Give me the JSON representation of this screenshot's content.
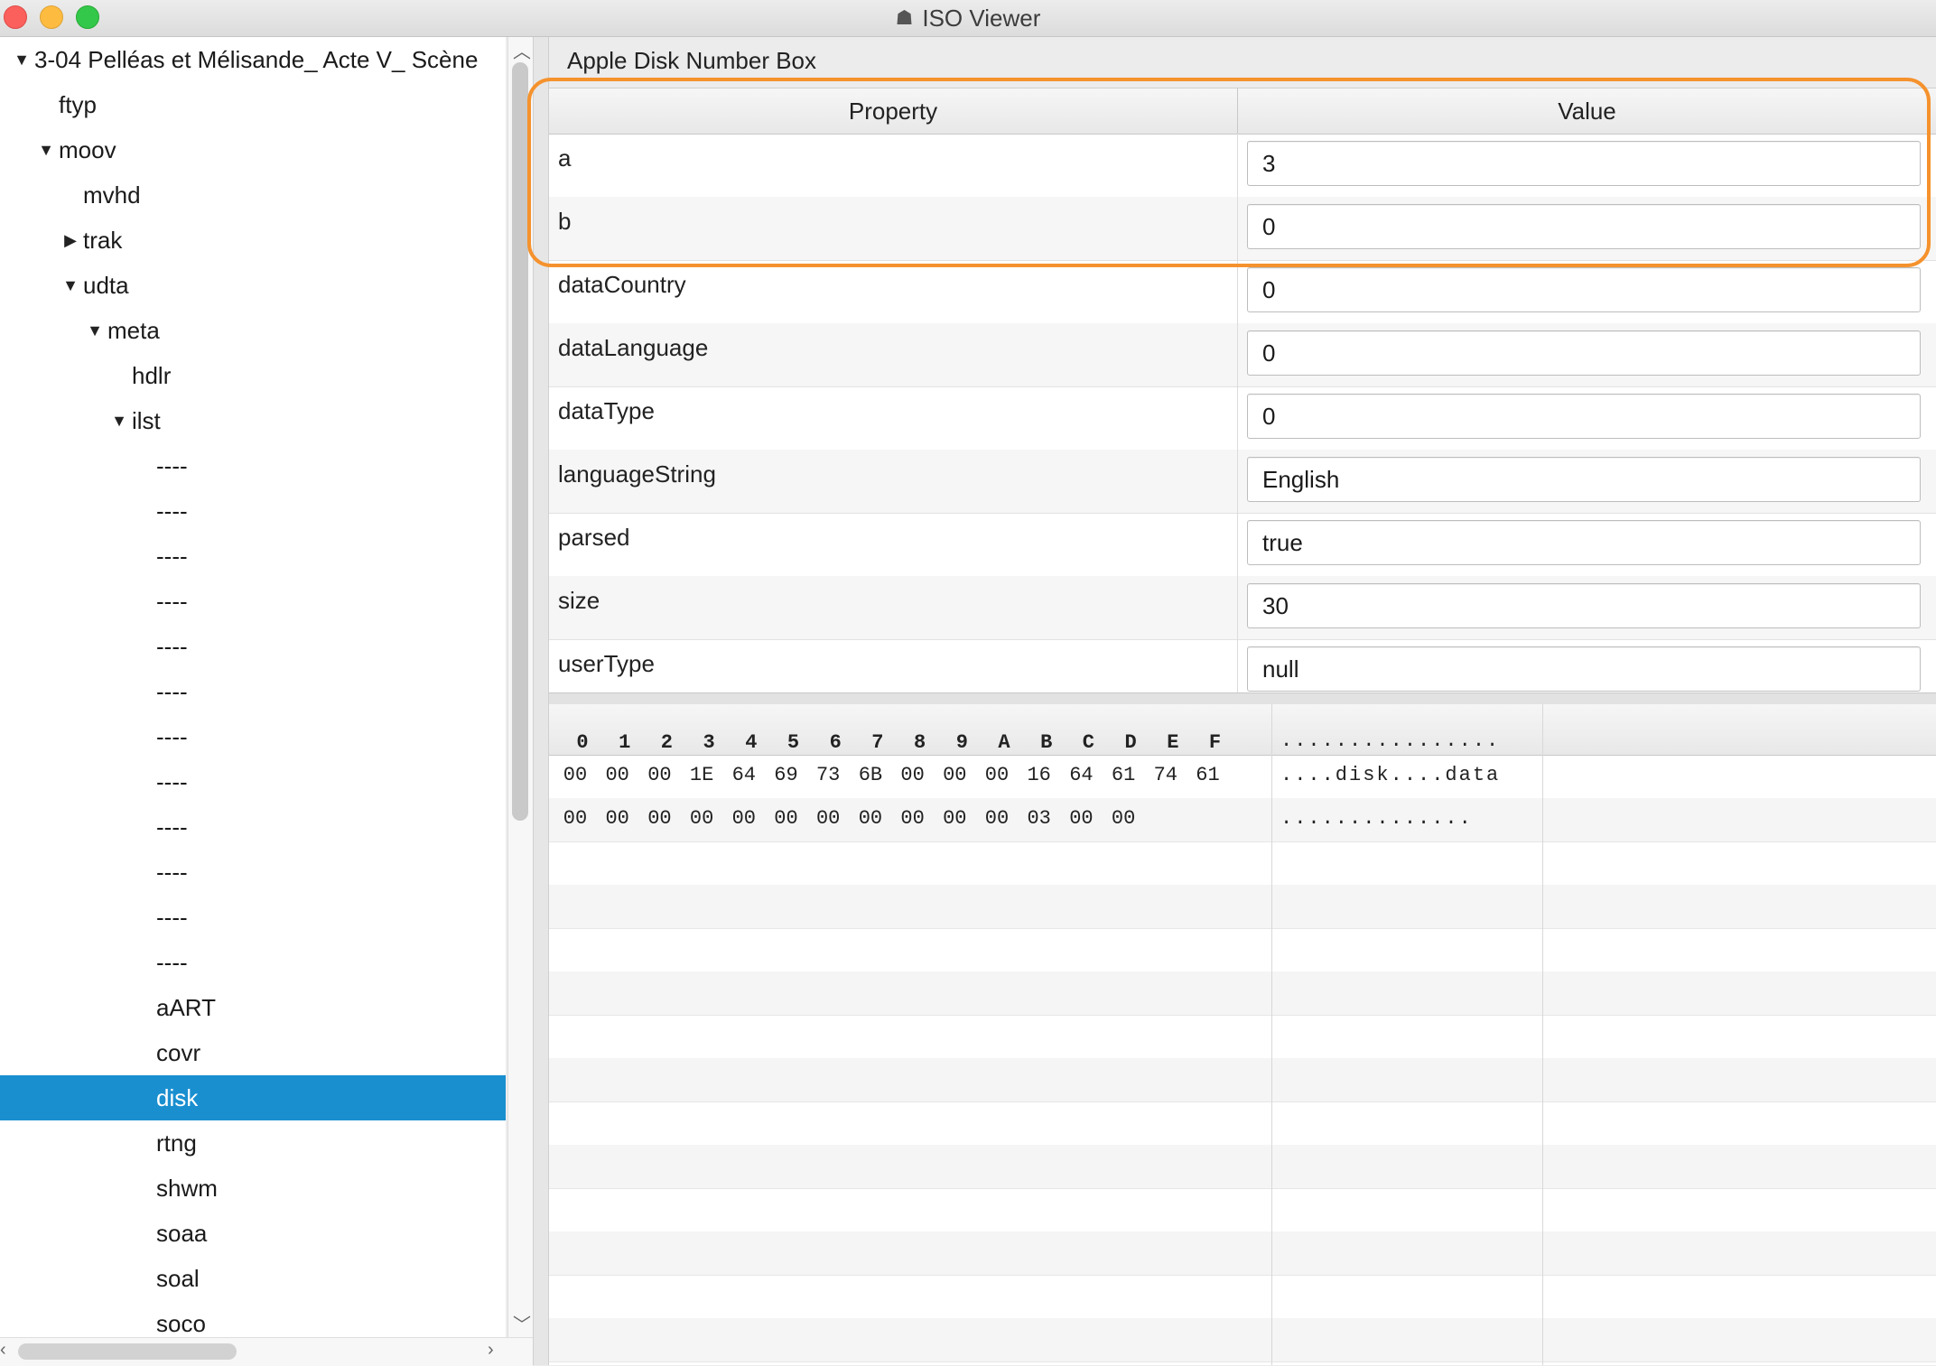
{
  "window": {
    "title": "ISO Viewer",
    "app_icon": "iso-viewer-icon"
  },
  "tree": {
    "items": [
      {
        "label": "3-04 Pelléas et Mélisande_ Acte V_ Scène",
        "depth": 0,
        "toggle": "expanded"
      },
      {
        "label": "ftyp",
        "depth": 1,
        "toggle": "none"
      },
      {
        "label": "moov",
        "depth": 1,
        "toggle": "expanded"
      },
      {
        "label": "mvhd",
        "depth": 2,
        "toggle": "none"
      },
      {
        "label": "trak",
        "depth": 2,
        "toggle": "collapsed"
      },
      {
        "label": "udta",
        "depth": 2,
        "toggle": "expanded"
      },
      {
        "label": "meta",
        "depth": 3,
        "toggle": "expanded"
      },
      {
        "label": "hdlr",
        "depth": 4,
        "toggle": "none"
      },
      {
        "label": "ilst",
        "depth": 4,
        "toggle": "expanded"
      },
      {
        "label": "----",
        "depth": 5,
        "toggle": "none"
      },
      {
        "label": "----",
        "depth": 5,
        "toggle": "none"
      },
      {
        "label": "----",
        "depth": 5,
        "toggle": "none"
      },
      {
        "label": "----",
        "depth": 5,
        "toggle": "none"
      },
      {
        "label": "----",
        "depth": 5,
        "toggle": "none"
      },
      {
        "label": "----",
        "depth": 5,
        "toggle": "none"
      },
      {
        "label": "----",
        "depth": 5,
        "toggle": "none"
      },
      {
        "label": "----",
        "depth": 5,
        "toggle": "none"
      },
      {
        "label": "----",
        "depth": 5,
        "toggle": "none"
      },
      {
        "label": "----",
        "depth": 5,
        "toggle": "none"
      },
      {
        "label": "----",
        "depth": 5,
        "toggle": "none"
      },
      {
        "label": "----",
        "depth": 5,
        "toggle": "none"
      },
      {
        "label": "aART",
        "depth": 5,
        "toggle": "none"
      },
      {
        "label": "covr",
        "depth": 5,
        "toggle": "none"
      },
      {
        "label": "disk",
        "depth": 5,
        "toggle": "none",
        "selected": true
      },
      {
        "label": "rtng",
        "depth": 5,
        "toggle": "none"
      },
      {
        "label": "shwm",
        "depth": 5,
        "toggle": "none"
      },
      {
        "label": "soaa",
        "depth": 5,
        "toggle": "none"
      },
      {
        "label": "soal",
        "depth": 5,
        "toggle": "none"
      },
      {
        "label": "soco",
        "depth": 5,
        "toggle": "none"
      }
    ],
    "selection_color": "#1a8fd0"
  },
  "detail": {
    "box_title": "Apple Disk Number Box",
    "columns": {
      "property": "Property",
      "value": "Value"
    },
    "rows": [
      {
        "name": "a",
        "value": "3"
      },
      {
        "name": "b",
        "value": "0"
      },
      {
        "name": "dataCountry",
        "value": "0"
      },
      {
        "name": "dataLanguage",
        "value": "0"
      },
      {
        "name": "dataType",
        "value": "0"
      },
      {
        "name": "languageString",
        "value": "English"
      },
      {
        "name": "parsed",
        "value": "true"
      },
      {
        "name": "size",
        "value": "30"
      },
      {
        "name": "userType",
        "value": "null"
      }
    ],
    "highlight_color": "#f5922d"
  },
  "hex": {
    "columns": [
      "0",
      "1",
      "2",
      "3",
      "4",
      "5",
      "6",
      "7",
      "8",
      "9",
      "A",
      "B",
      "C",
      "D",
      "E",
      "F"
    ],
    "ascii_header": "................",
    "rows": [
      {
        "bytes": [
          "00",
          "00",
          "00",
          "1E",
          "64",
          "69",
          "73",
          "6B",
          "00",
          "00",
          "00",
          "16",
          "64",
          "61",
          "74",
          "61"
        ],
        "ascii": "....disk....data"
      },
      {
        "bytes": [
          "00",
          "00",
          "00",
          "00",
          "00",
          "00",
          "00",
          "00",
          "00",
          "00",
          "00",
          "03",
          "00",
          "00"
        ],
        "ascii": ".............."
      }
    ]
  }
}
